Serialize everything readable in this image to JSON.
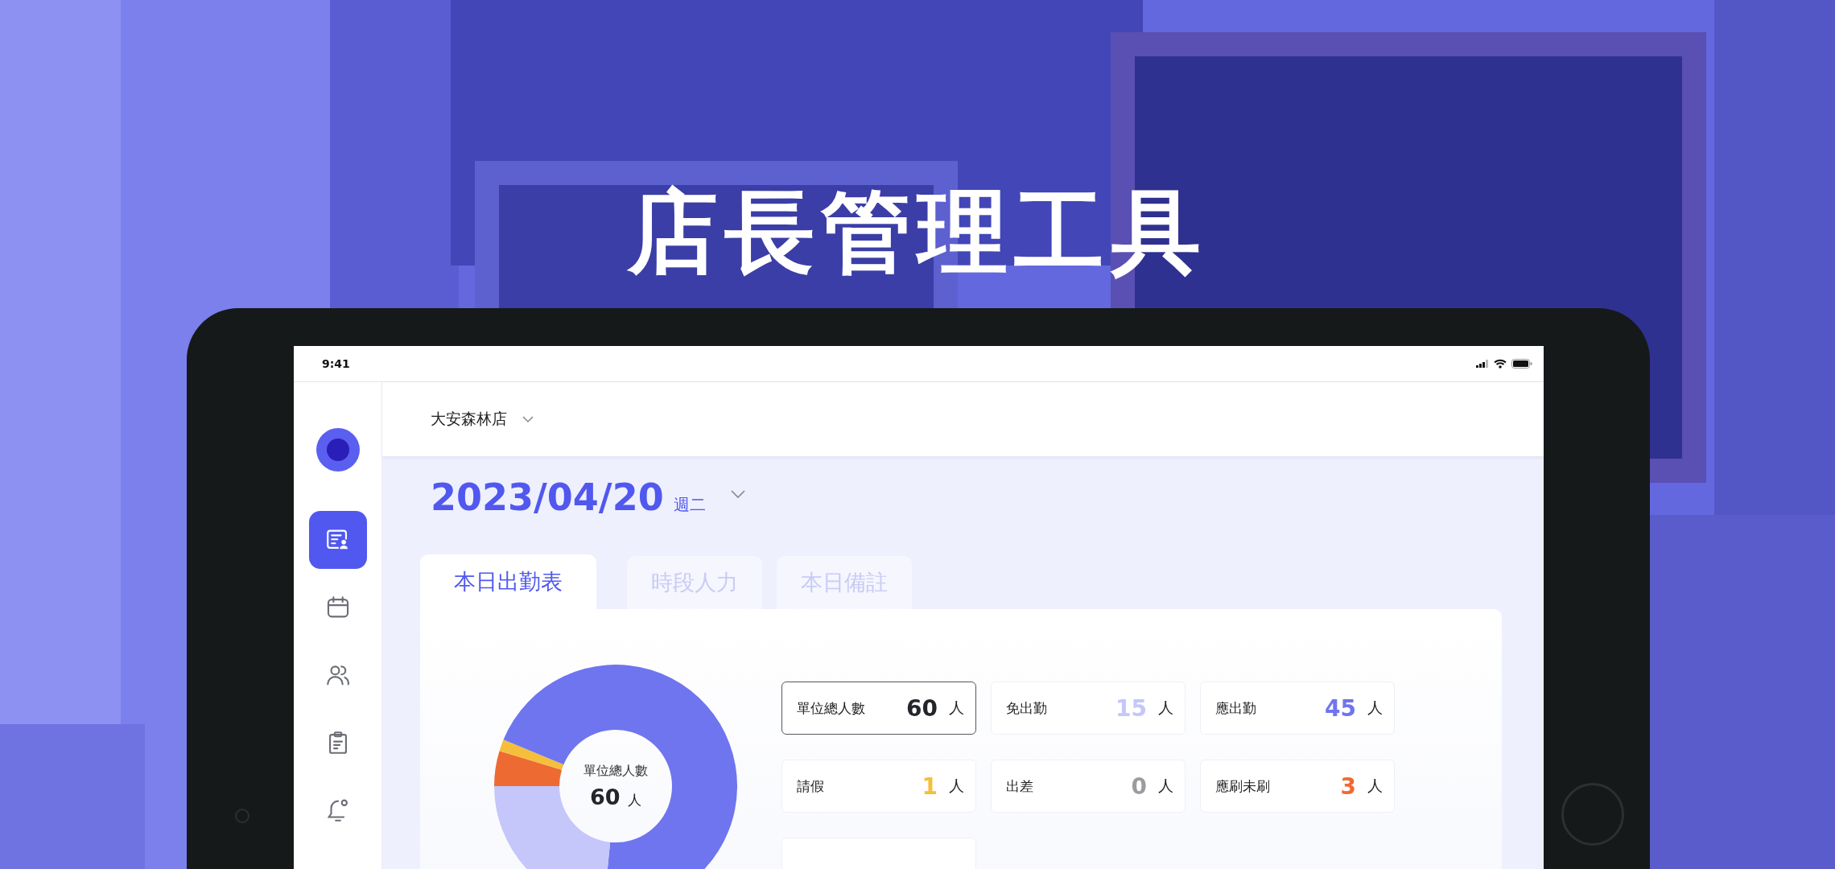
{
  "banner_title": "店長管理工具",
  "status_bar": {
    "time": "9:41"
  },
  "nav": [
    {
      "kind": "roster",
      "selected": true
    },
    {
      "kind": "calendar",
      "selected": false
    },
    {
      "kind": "people",
      "selected": false
    },
    {
      "kind": "clipboard",
      "selected": false
    },
    {
      "kind": "bell",
      "selected": false
    }
  ],
  "store_selector": {
    "label": "大安森林店"
  },
  "date": {
    "value": "2023/04/20",
    "weekday": "週二"
  },
  "tabs": [
    {
      "label": "本日出勤表",
      "selected": true
    },
    {
      "label": "時段人力",
      "selected": false
    },
    {
      "label": "本日備註",
      "selected": false
    }
  ],
  "donut_center": {
    "label": "單位總人數",
    "value": "60",
    "unit": "人"
  },
  "stats": [
    {
      "kind": "count",
      "label": "單位總人數",
      "value": "60",
      "unit": "人",
      "color": "#22262b",
      "selected": true
    },
    {
      "kind": "count",
      "label": "免出勤",
      "value": "15",
      "unit": "人",
      "color": "#c5c6fa",
      "selected": false
    },
    {
      "kind": "count",
      "label": "應出勤",
      "value": "45",
      "unit": "人",
      "color": "#6f75ee",
      "selected": false
    },
    {
      "kind": "count",
      "label": "請假",
      "value": "1",
      "unit": "人",
      "color": "#f5bf3c",
      "selected": false
    },
    {
      "kind": "count",
      "label": "出差",
      "value": "0",
      "unit": "人",
      "color": "#9a9ca0",
      "selected": false
    },
    {
      "kind": "count",
      "label": "應刷未刷",
      "value": "3",
      "unit": "人",
      "color": "#ee6a33",
      "selected": false
    },
    {
      "kind": "blank"
    }
  ]
}
